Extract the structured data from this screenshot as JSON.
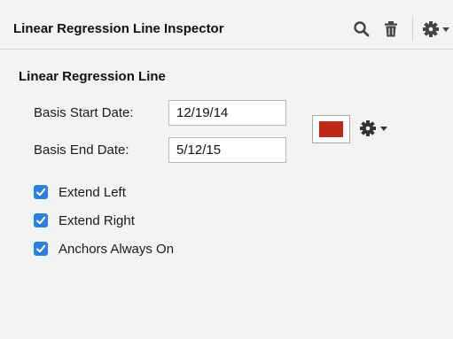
{
  "header": {
    "title": "Linear Regression Line Inspector",
    "icons": [
      "search-icon",
      "trash-icon",
      "gear-icon",
      "chevron-down-icon"
    ]
  },
  "section": {
    "title": "Linear Regression Line"
  },
  "fields": {
    "start_label": "Basis Start Date:",
    "start_value": "12/19/14",
    "end_label": "Basis End Date:",
    "end_value": "5/12/15"
  },
  "color": {
    "line_color": "#c0281a",
    "icons": [
      "gear-icon",
      "chevron-down-icon"
    ]
  },
  "options": [
    {
      "label": "Extend Left",
      "checked": true
    },
    {
      "label": "Extend Right",
      "checked": true
    },
    {
      "label": "Anchors Always On",
      "checked": true
    }
  ],
  "theme": {
    "checkbox_color": "#2f7fe0",
    "panel_background": "#f3f3f3"
  }
}
